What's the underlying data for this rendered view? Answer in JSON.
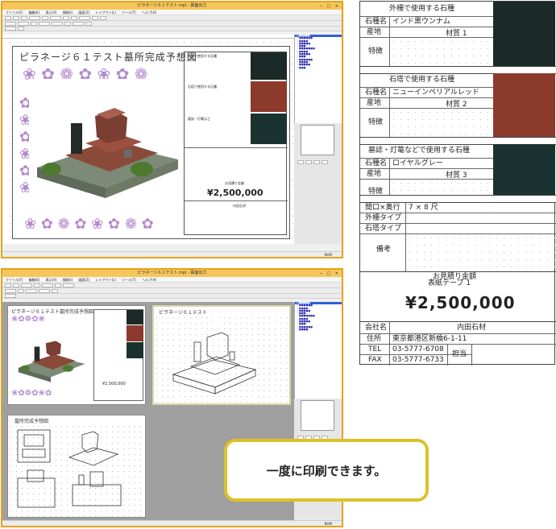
{
  "top_window": {
    "title": "ピラネージ６１テスト.mpl - 図面出力",
    "menu": [
      "ファイル(F)",
      "編集(E)",
      "表示(V)",
      "情報(I)",
      "図面(Z)",
      "レイアウト(L)",
      "ツール(T)",
      "ヘルプ(H)"
    ],
    "status": "NUM"
  },
  "bottom_window": {
    "title": "ピラネージ６１テスト.mpl - 図面出力",
    "status": "NUM"
  },
  "sheet": {
    "title": "ピラネージ６１テスト墓所完成予想図",
    "price": "¥2,500,000",
    "price_label": "お見積り金額",
    "company": "内田石材"
  },
  "bottom_sheets": {
    "perspective_title": "ピラネージ６１テスト",
    "plan_title": "墓所完成予想図"
  },
  "big_table": {
    "section1_header": "外柵で使用する石種",
    "section2_header": "石塔で使用する石種",
    "section3_header": "墓誌・灯篭などで使用する石種",
    "label_stone": "石種名",
    "label_origin": "産地",
    "label_feature": "特徴",
    "stone1": "インド黒ウンナム",
    "stone2": "ニューインペリアルレッド",
    "stone3": "ロイヤルグレー",
    "material1": "材質 1",
    "material2": "材質 2",
    "material3": "材質 3",
    "size_label": "間口×奥行",
    "size_value": "7 × 8 尺",
    "fence_type": "外柵タイプ",
    "tower_type": "石塔タイプ",
    "remarks": "備考",
    "estimate_label": "お見積り金額",
    "estimate_sub": "表紙テーブ 1",
    "price": "¥2,500,000",
    "company_label": "会社名",
    "company": "内田石材",
    "address_label": "住所",
    "address": "東京都港区新橋6-1-11",
    "tel_label": "TEL",
    "tel": "03-5777-6708",
    "fax_label": "FAX",
    "fax": "03-5777-6733",
    "staff_label": "担当"
  },
  "swatch_colors": {
    "black": "#1b2a26",
    "red": "#8c3a2c",
    "gray": "#1a3330"
  },
  "callout": {
    "text": "一度に印刷できます。",
    "border_color": "#dcc22a"
  }
}
